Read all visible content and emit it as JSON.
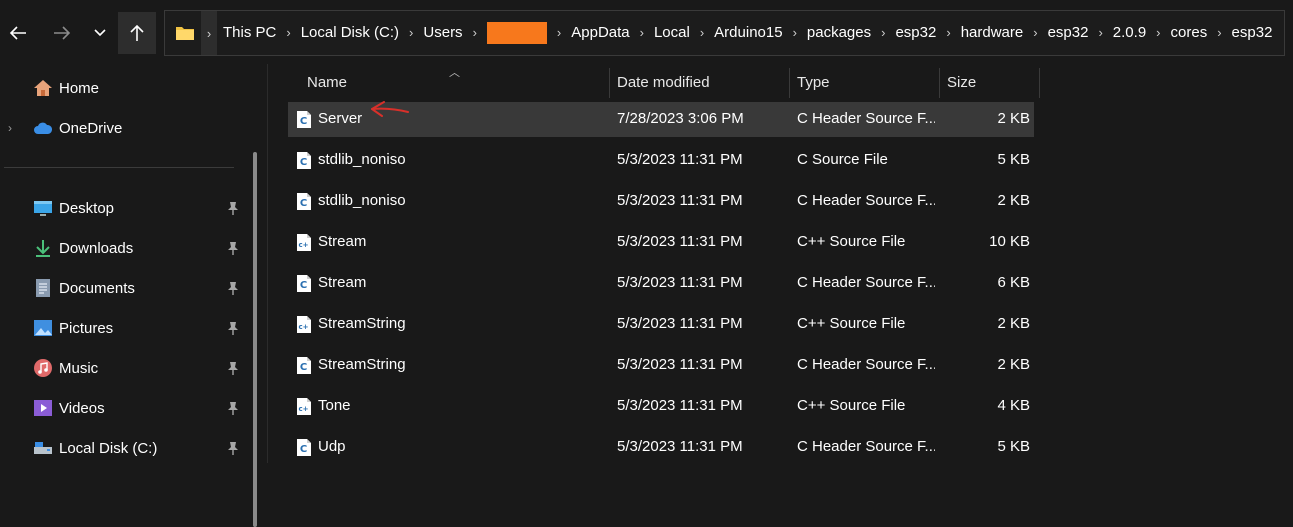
{
  "nav": {
    "back_icon": "arrow-left-icon",
    "forward_icon": "arrow-right-icon",
    "recent_icon": "chevron-down-icon",
    "up_icon": "arrow-up-icon"
  },
  "address_bar": {
    "folder_icon": "folder-icon",
    "crumbs": [
      "This PC",
      "Local Disk (C:)",
      "Users",
      "",
      "AppData",
      "Local",
      "Arduino15",
      "packages",
      "esp32",
      "hardware",
      "esp32",
      "2.0.9",
      "cores",
      "esp32"
    ],
    "redacted_color": "#f7781c"
  },
  "sidebar": {
    "home": "Home",
    "onedrive": "OneDrive",
    "quick_access": [
      {
        "label": "Desktop",
        "icon": "desktop-icon"
      },
      {
        "label": "Downloads",
        "icon": "download-icon"
      },
      {
        "label": "Documents",
        "icon": "documents-icon"
      },
      {
        "label": "Pictures",
        "icon": "pictures-icon"
      },
      {
        "label": "Music",
        "icon": "music-icon"
      },
      {
        "label": "Videos",
        "icon": "videos-icon"
      },
      {
        "label": "Local Disk (C:)",
        "icon": "drive-icon"
      }
    ]
  },
  "columns": {
    "name": "Name",
    "date": "Date modified",
    "type": "Type",
    "size": "Size"
  },
  "files": [
    {
      "name": "Server",
      "date": "7/28/2023 3:06 PM",
      "type": "C Header Source F...",
      "size": "2 KB",
      "icon": "c-file-icon",
      "selected": true
    },
    {
      "name": "stdlib_noniso",
      "date": "5/3/2023 11:31 PM",
      "type": "C Source File",
      "size": "5 KB",
      "icon": "c-file-icon"
    },
    {
      "name": "stdlib_noniso",
      "date": "5/3/2023 11:31 PM",
      "type": "C Header Source F...",
      "size": "2 KB",
      "icon": "c-file-icon"
    },
    {
      "name": "Stream",
      "date": "5/3/2023 11:31 PM",
      "type": "C++ Source File",
      "size": "10 KB",
      "icon": "cpp-file-icon"
    },
    {
      "name": "Stream",
      "date": "5/3/2023 11:31 PM",
      "type": "C Header Source F...",
      "size": "6 KB",
      "icon": "c-file-icon"
    },
    {
      "name": "StreamString",
      "date": "5/3/2023 11:31 PM",
      "type": "C++ Source File",
      "size": "2 KB",
      "icon": "cpp-file-icon"
    },
    {
      "name": "StreamString",
      "date": "5/3/2023 11:31 PM",
      "type": "C Header Source F...",
      "size": "2 KB",
      "icon": "c-file-icon"
    },
    {
      "name": "Tone",
      "date": "5/3/2023 11:31 PM",
      "type": "C++ Source File",
      "size": "4 KB",
      "icon": "cpp-file-icon"
    },
    {
      "name": "Udp",
      "date": "5/3/2023 11:31 PM",
      "type": "C Header Source F...",
      "size": "5 KB",
      "icon": "c-file-icon"
    }
  ],
  "annotation": {
    "icon": "red-arrow-icon",
    "color": "#d8302a"
  }
}
